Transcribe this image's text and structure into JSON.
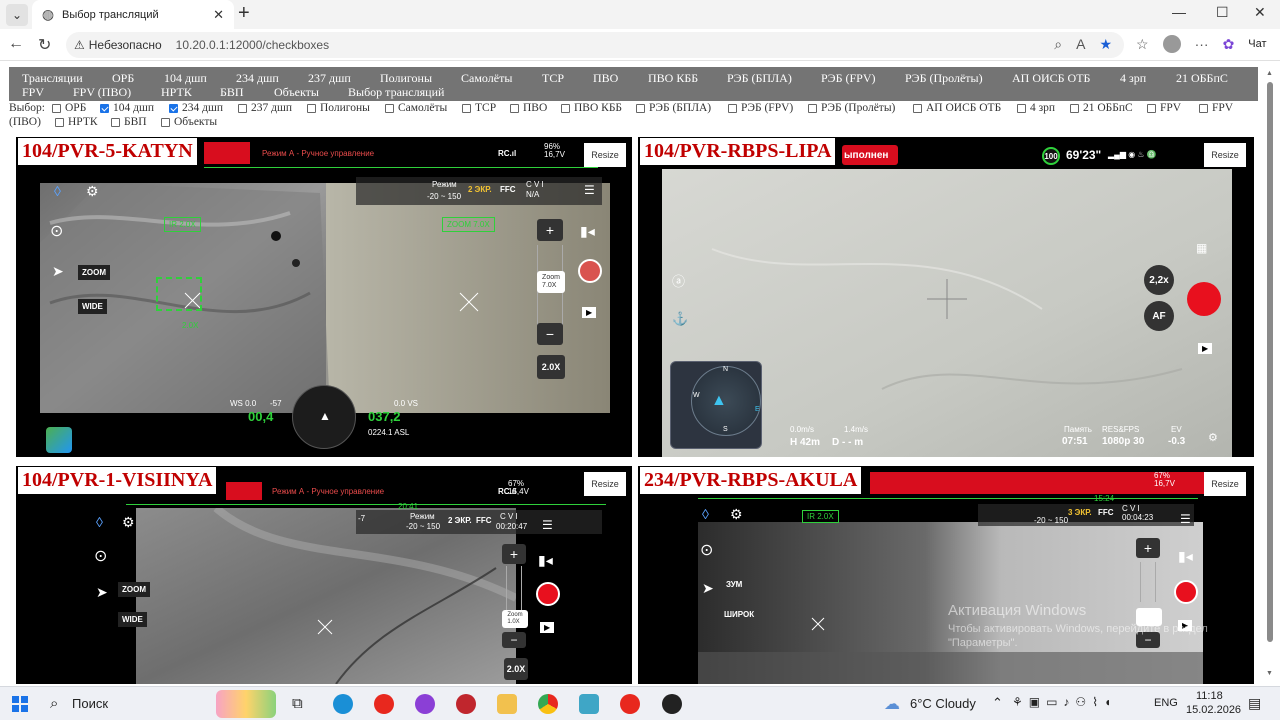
{
  "browser": {
    "tab_title": "Выбор трансляций",
    "security_label": "Небезопасно",
    "url": "10.20.0.1:12000/checkboxes",
    "chat_label": "Чат"
  },
  "nav": {
    "row1": [
      "Трансляции",
      "ОРБ",
      "104 дшп",
      "234 дшп",
      "237 дшп",
      "Полигоны",
      "Самолёты",
      "ТСР",
      "ПВО",
      "ПВО КББ",
      "РЭБ (БПЛА)",
      "РЭБ (FPV)",
      "РЭБ (Пролёты)",
      "АП ОИСБ ОТБ",
      "4 зрп",
      "21 ОББпС"
    ],
    "row2": [
      "FPV",
      "FPV (ПВО)",
      "НРТК",
      "БВП",
      "Объекты",
      "Выбор трансляций"
    ]
  },
  "filter": {
    "label": "Выбор:",
    "items": [
      {
        "label": "ОРБ",
        "checked": false
      },
      {
        "label": "104 дшп",
        "checked": true
      },
      {
        "label": "234 дшп",
        "checked": true
      },
      {
        "label": "237 дшп",
        "checked": false
      },
      {
        "label": "Полигоны",
        "checked": false
      },
      {
        "label": "Самолёты",
        "checked": false
      },
      {
        "label": "ТСР",
        "checked": false
      },
      {
        "label": "ПВО",
        "checked": false
      },
      {
        "label": "ПВО КББ",
        "checked": false
      },
      {
        "label": "РЭБ (БПЛА)",
        "checked": false
      },
      {
        "label": "РЭБ (FPV)",
        "checked": false
      },
      {
        "label": "РЭБ (Пролёты)",
        "checked": false
      },
      {
        "label": "АП ОИСБ ОТБ",
        "checked": false
      },
      {
        "label": "4 зрп",
        "checked": false
      },
      {
        "label": "21 ОББпС",
        "checked": false
      },
      {
        "label": "FPV",
        "checked": false
      },
      {
        "label": "FPV",
        "checked": false
      },
      {
        "label": "(ПВО)",
        "checked": false
      },
      {
        "label": "НРТК",
        "checked": false
      },
      {
        "label": "БВП",
        "checked": false
      },
      {
        "label": "Объекты",
        "checked": false
      }
    ]
  },
  "panels": [
    {
      "title": "104/PVR-5-KATYN",
      "resize": "Resize",
      "mode_text": "Режим А - Ручное управление",
      "battery": "96%\n16,7V",
      "rc": "RC.ıl",
      "zoom_ir": "IR 2.0X",
      "zoom_label": "ZOOM",
      "wide_label": "WIDE",
      "zoom_value": "7.0X",
      "zoom_text": "Zoom\n7.0X",
      "ir_value": "2.0X",
      "range": "-20 ~ 150",
      "ekr": "2 ЭКР.",
      "ffc": "FFC",
      "cvi": "C V I\nN/A",
      "regime": "Режим",
      "zoom_ovl": "ZOOM 7.0X",
      "ws": "WS 0.0",
      "hs": "00,4",
      "alt": "037,2",
      "asl": "0224.1 ASL",
      "neg57": "-57",
      "vs": "0.0 VS",
      "zoom_small": "2.0X"
    },
    {
      "title": "104/PVR-RBPS-LIPA",
      "resize": "Resize",
      "status": "ыполнен",
      "battery_pct": "100",
      "time_left": "69'23\"",
      "zoom_btn": "2,2x",
      "af_btn": "AF",
      "speed1": "0.0m/s",
      "speed2": "1.4m/s",
      "height": "H 42m",
      "dist": "D - - m",
      "mem_label": "Память",
      "mem_val": "07:51",
      "res_label": "RES&FPS",
      "res_val": "1080p 30",
      "ev_label": "EV",
      "ev_val": "-0.3",
      "compass_n": "N",
      "compass_w": "W",
      "compass_e": "E",
      "compass_s": "S"
    },
    {
      "title": "104/PVR-1-VISIINYA",
      "resize": "Resize",
      "mode_text": "Режим А - Ручное управление",
      "battery": "67%\n15,4V",
      "rc": "RC.ıl",
      "zoom_label": "ZOOM",
      "wide_label": "WIDE",
      "time": "20:41",
      "time2": "00:20:47",
      "range": "-20 ~ 150",
      "ekr": "2 ЭКР.",
      "ffc": "FFC",
      "cvi": "C V I",
      "regime": "Режим",
      "zoom_text": "Zoom\n1.0X",
      "ir_value": "2.0X",
      "neg7": "-7"
    },
    {
      "title": "234/PVR-RBPS-AKULA",
      "resize": "Resize",
      "battery": "67%\n16,7V",
      "time": "15:24",
      "zoom_ir": "IR 2.0X",
      "ekr": "3 ЭКР.",
      "ffc": "FFC",
      "cvi": "C V I\n00:04:23",
      "range": "-20 ~ 150",
      "zoom_label": "ЗУМ",
      "wide_label": "ШИРОК"
    }
  ],
  "watermark": {
    "line1": "Активация Windows",
    "line2": "Чтобы активировать Windows, перейдите в раздел",
    "line3": "\"Параметры\"."
  },
  "taskbar": {
    "search": "Поиск",
    "weather": "6°C  Cloudy",
    "lang": "ENG",
    "time": "11:18",
    "date": "15.02.2026"
  },
  "colors": {
    "title_red": "#c00000",
    "nav_bg": "#747474",
    "rec_red": "#e8101e",
    "hud_green": "#2fd03b",
    "accent_blue": "#1a73e8"
  }
}
